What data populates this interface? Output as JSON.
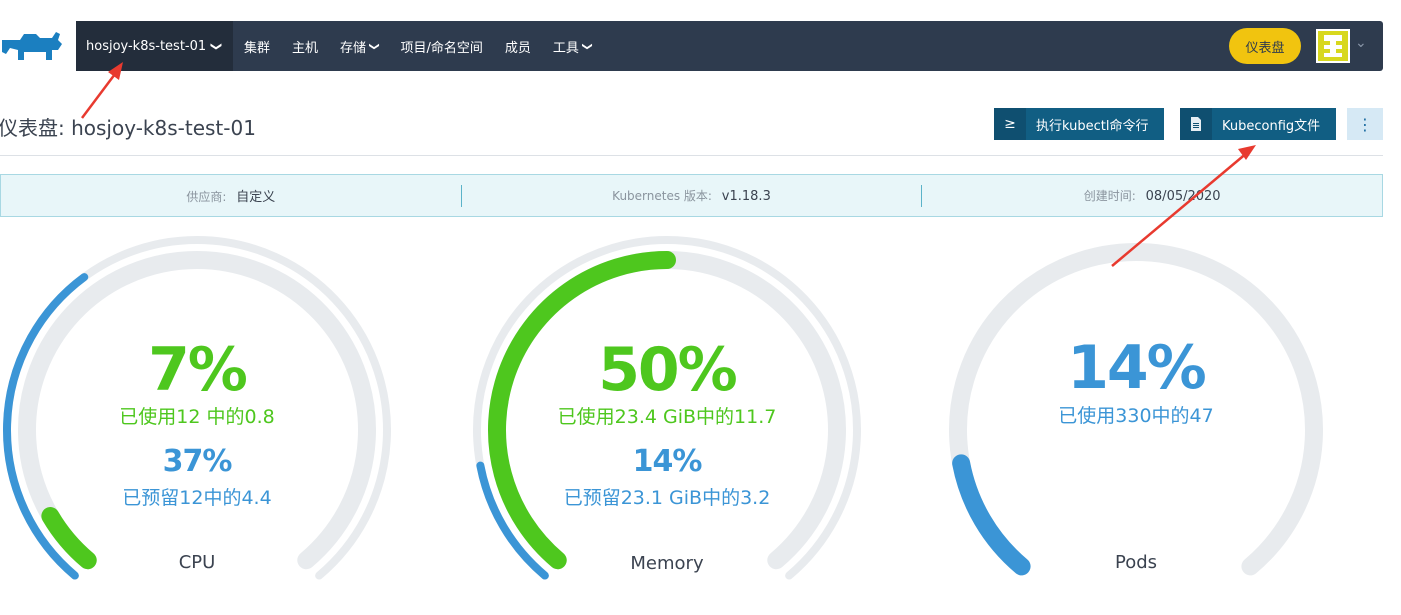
{
  "navbar": {
    "cluster_name": "hosjoy-k8s-test-01",
    "items": [
      {
        "label": "集群",
        "dropdown": false
      },
      {
        "label": "主机",
        "dropdown": false
      },
      {
        "label": "存储",
        "dropdown": true
      },
      {
        "label": "项目/命名空间",
        "dropdown": false
      },
      {
        "label": "成员",
        "dropdown": false
      },
      {
        "label": "工具",
        "dropdown": true
      }
    ],
    "dashboard_button": "仪表盘"
  },
  "header": {
    "title": "仪表盘: hosjoy-k8s-test-01",
    "kubectl_button": "执行kubectl命令行",
    "kubeconfig_button": "Kubeconfig文件",
    "more_button": "⋮"
  },
  "banner": {
    "provider_label": "供应商:",
    "provider_value": "自定义",
    "k8s_label": "Kubernetes 版本:",
    "k8s_value": "v1.18.3",
    "created_label": "创建时间:",
    "created_value": "08/05/2020"
  },
  "gauges": [
    {
      "name": "CPU",
      "used_pct": "7%",
      "used_text": "已使用12 中的0.8",
      "reserved_pct": "37%",
      "reserved_text": "已预留12中的4.4",
      "used_fraction": 0.07,
      "reserved_fraction": 0.37
    },
    {
      "name": "Memory",
      "used_pct": "50%",
      "used_text": "已使用23.4 GiB中的11.7",
      "reserved_pct": "14%",
      "reserved_text": "已预留23.1 GiB中的3.2",
      "used_fraction": 0.5,
      "reserved_fraction": 0.14
    },
    {
      "name": "Pods",
      "used_pct": "14%",
      "used_text": "已使用330中的47",
      "used_fraction": 0.14
    }
  ],
  "colors": {
    "navbar": "#2e3b4e",
    "accent_yellow": "#f1c40f",
    "used_green": "#4ec71e",
    "reserved_blue": "#3b95d6",
    "track": "#e8ebee",
    "button_blue": "#115e83",
    "annotation_red": "#e83a2f"
  }
}
